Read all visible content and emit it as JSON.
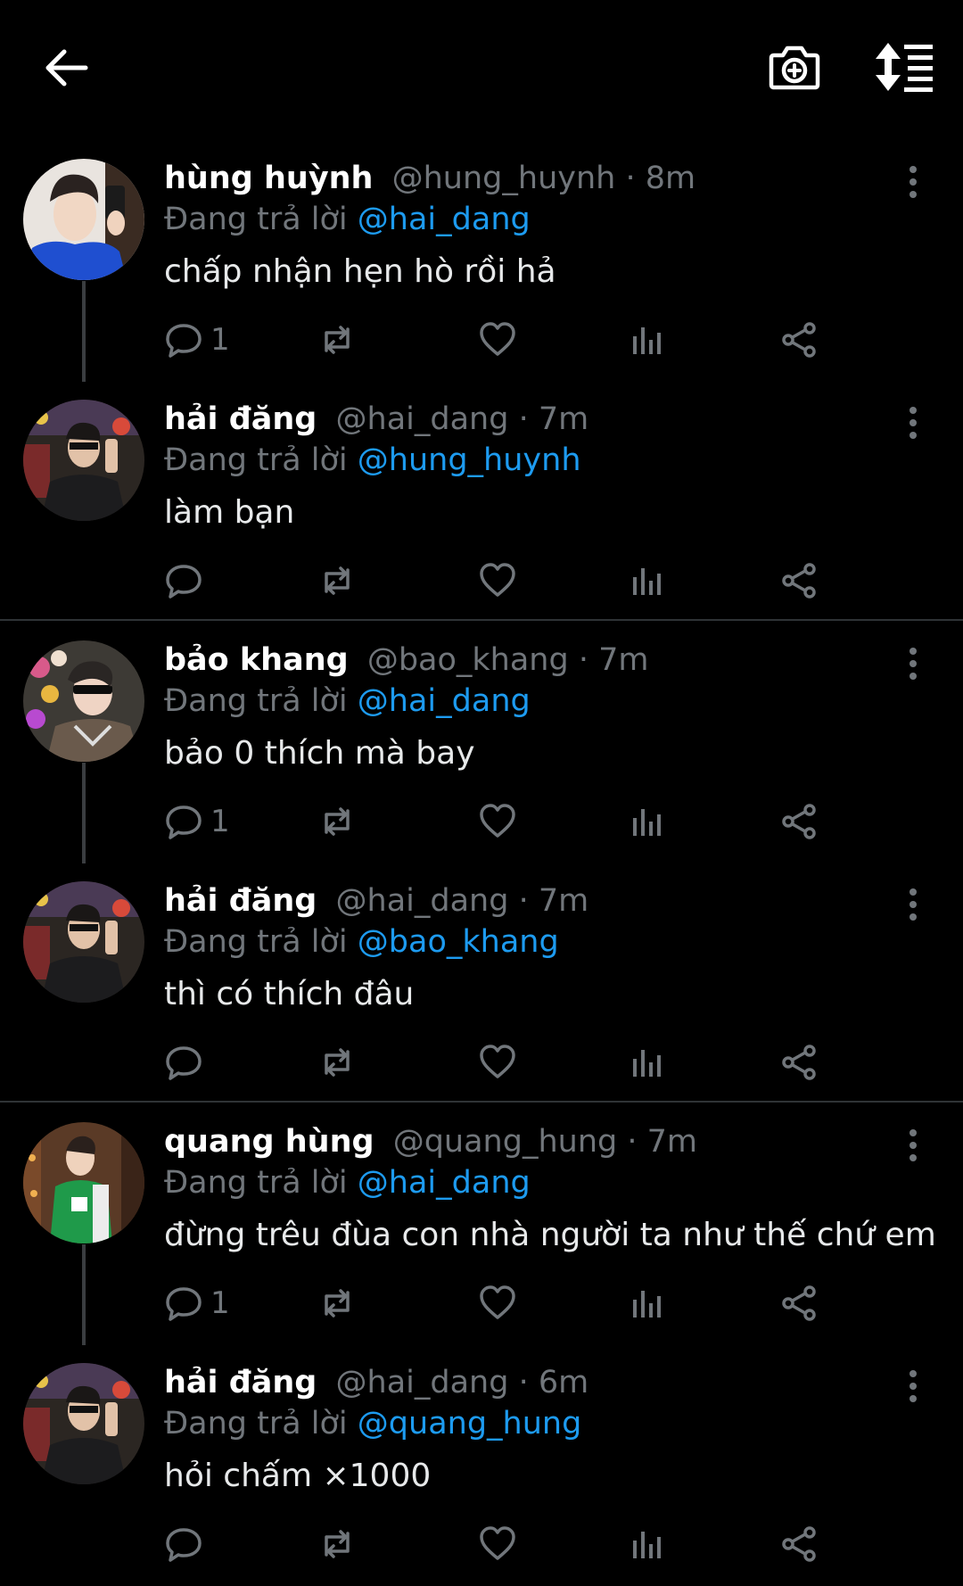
{
  "topbar": {
    "back_icon": "arrow-left-icon",
    "camera_icon": "camera-add-icon",
    "sort_icon": "sort-icon"
  },
  "colors": {
    "background": "#000000",
    "name": "#ffffff",
    "muted": "#71767b",
    "mention": "#1d9bf0",
    "divider": "#2f3336"
  },
  "tweets": [
    {
      "name": "hùng huỳnh",
      "handle": "@hung_huynh",
      "sep": "·",
      "time": "8m",
      "replying_prefix": "Đang trả lời",
      "replying_to": "@hai_dang",
      "text": "chấp nhận hẹn hò rồi hả",
      "reply_count": "1"
    },
    {
      "name": "hải đăng",
      "handle": "@hai_dang",
      "sep": "·",
      "time": "7m",
      "replying_prefix": "Đang trả lời",
      "replying_to": "@hung_huynh",
      "text": "làm bạn",
      "reply_count": ""
    },
    {
      "name": "bảo khang",
      "handle": "@bao_khang",
      "sep": "·",
      "time": "7m",
      "replying_prefix": "Đang trả lời",
      "replying_to": "@hai_dang",
      "text": "bảo 0 thích mà bay",
      "reply_count": "1"
    },
    {
      "name": "hải đăng",
      "handle": "@hai_dang",
      "sep": "·",
      "time": "7m",
      "replying_prefix": "Đang trả lời",
      "replying_to": "@bao_khang",
      "text": "thì có thích đâu",
      "reply_count": ""
    },
    {
      "name": "quang hùng",
      "handle": "@quang_hung",
      "sep": "·",
      "time": "7m",
      "replying_prefix": "Đang trả lời",
      "replying_to": "@hai_dang",
      "text": "đừng trêu đùa con nhà người ta như thế chứ em",
      "reply_count": "1"
    },
    {
      "name": "hải đăng",
      "handle": "@hai_dang",
      "sep": "·",
      "time": "6m",
      "replying_prefix": "Đang trả lời",
      "replying_to": "@quang_hung",
      "text": "hỏi chấm ×1000",
      "reply_count": ""
    }
  ]
}
